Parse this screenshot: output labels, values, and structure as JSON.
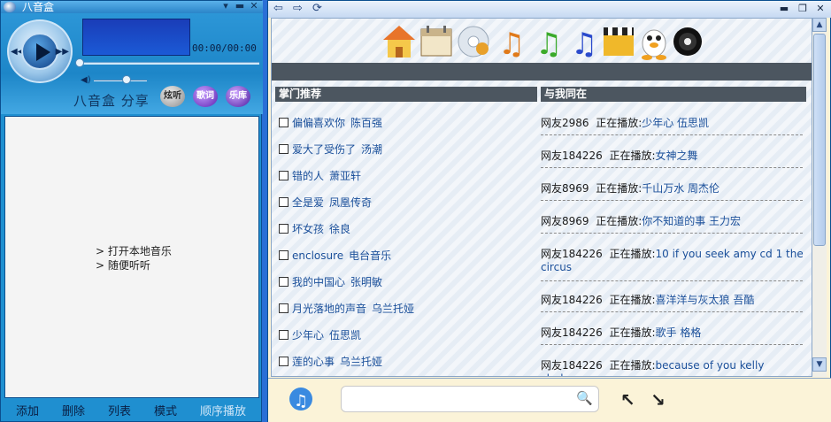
{
  "player": {
    "title": "八音盒",
    "timer": "00:00/00:00",
    "brand": "八音盒 分享",
    "buttons": [
      "炫听",
      "歌词",
      "乐库"
    ],
    "playlist_links": [
      "> 打开本地音乐",
      "> 随便听听"
    ],
    "bottom": [
      "添加",
      "删除",
      "列表",
      "模式",
      "顺序播放"
    ]
  },
  "browser": {
    "recommend_title": "掌门推荐",
    "friends_title": "与我同在",
    "recommend": [
      {
        "song": "偏偏喜欢你",
        "artist": "陈百强"
      },
      {
        "song": "爱大了受伤了",
        "artist": "汤潮"
      },
      {
        "song": "错的人",
        "artist": "萧亚轩"
      },
      {
        "song": "全是爱",
        "artist": "凤凰传奇"
      },
      {
        "song": "坏女孩",
        "artist": "徐良"
      },
      {
        "song": "enclosure",
        "artist": "电台音乐"
      },
      {
        "song": "我的中国心",
        "artist": "张明敏"
      },
      {
        "song": "月光落地的声音",
        "artist": "乌兰托娅"
      },
      {
        "song": "少年心",
        "artist": "伍思凯"
      },
      {
        "song": "莲的心事",
        "artist": "乌兰托娅"
      }
    ],
    "friends": [
      {
        "user": "网友2986",
        "status": "正在播放:",
        "song": "少年心 伍思凯"
      },
      {
        "user": "网友184226",
        "status": "正在播放:",
        "song": "女神之舞"
      },
      {
        "user": "网友8969",
        "status": "正在播放:",
        "song": "千山万水 周杰伦"
      },
      {
        "user": "网友8969",
        "status": "正在播放:",
        "song": "你不知道的事 王力宏"
      },
      {
        "user": "网友184226",
        "status": "正在播放:",
        "song": "10 if you seek amy cd 1 the circus"
      },
      {
        "user": "网友184226",
        "status": "正在播放:",
        "song": "喜洋洋与灰太狼 吾酷"
      },
      {
        "user": "网友184226",
        "status": "正在播放:",
        "song": "歌手 格格"
      },
      {
        "user": "网友184226",
        "status": "正在播放:",
        "song": "because of you kelly clarkson"
      }
    ]
  }
}
